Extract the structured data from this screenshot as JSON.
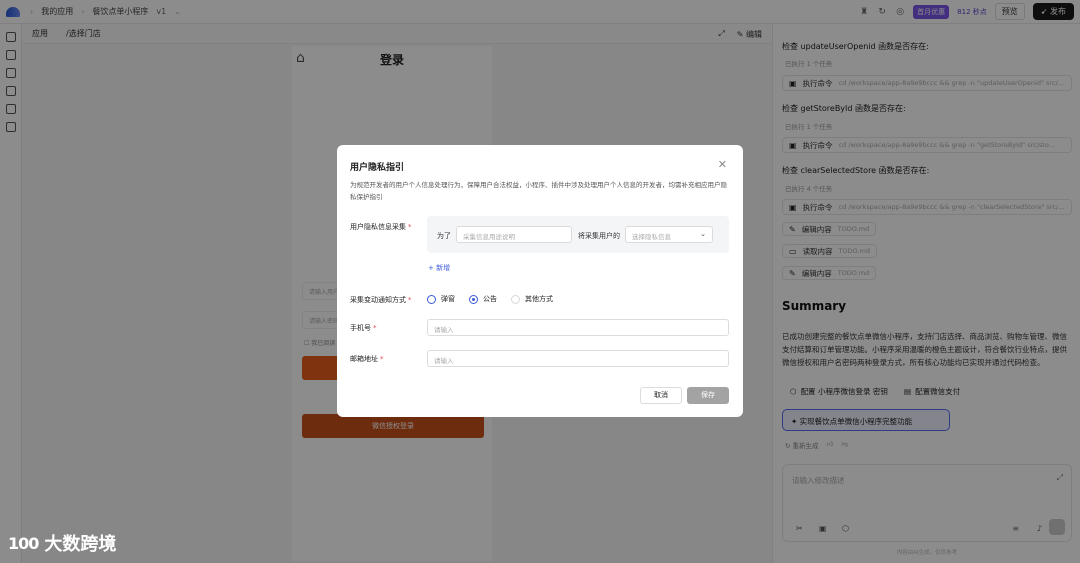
{
  "topbar": {
    "crumb1": "我的应用",
    "crumb2": "餐饮点单小程序",
    "version": "v1",
    "badge": "首月优惠",
    "credits": "812 秒点",
    "preview_btn": "预览",
    "publish_btn": "发布"
  },
  "preview": {
    "tab_app": "应用",
    "tab_path": "/选择门店",
    "edit": "编辑",
    "login_title": "登录",
    "input1": "请输入用户",
    "input2": "请输入密码",
    "check": "我已阅读",
    "wechat_login": "微信授权登录"
  },
  "panel": {
    "check1": "检查 updateUserOpenid 函数是否存在:",
    "sub1": "已执行 1 个任务",
    "cmd_label": "执行命令",
    "cmd1": "cd /workspace/app-8a9e9bccc && grep -n \"updateUserOpenid\" src/...",
    "check2": "检查 getStoreById 函数是否存在:",
    "sub2": "已执行 1 个任务",
    "cmd2": "cd /workspace/app-8a9e9bccc && grep -n \"getStoreById\" src/sto...",
    "check3": "检查 clearSelectedStore 函数是否存在:",
    "sub3": "已执行 4 个任务",
    "cmd3": "cd /workspace/app-8a9e9bccc && grep -n \"clearSelectedStore\" src/...",
    "edit_label": "编辑内容",
    "edit_file": "TODO.md",
    "read_label": "读取内容",
    "read_file": "TODO.md",
    "edit2_label": "编辑内容",
    "edit2_file": "TODO.md",
    "summary_title": "Summary",
    "summary_text": "已成功创建完整的餐饮点单微信小程序，支持门店选择、商品浏览、购物车管理、微信支付结算和订单管理功能。小程序采用温暖的橙色主题设计，符合餐饮行业特点，提供微信授权和用户名密码两种登录方式，所有核心功能均已实现并通过代码检查。",
    "action1": "配置 小程序微信登录 密钥",
    "action2": "配置微信支付",
    "task_tag": "实现餐饮点单微信小程序完整功能",
    "regen": "重新生成",
    "chat_placeholder": "请输入修改描述",
    "footer": "内容由AI生成，仅供参考"
  },
  "dialog": {
    "title": "用户隐私指引",
    "desc": "为规范开发者的用户个人信息处理行为，保障用户合法权益，小程序、插件中涉及处理用户个人信息的开发者，均需补充相应用户隐私保护指引",
    "label_collect": "用户隐私信息采集",
    "for_text": "为了",
    "purpose_placeholder": "采集信息用途说明",
    "will_collect": "将采集用户的",
    "select_placeholder": "选择隐私信息",
    "add_link": "+ 新增",
    "label_notify": "采集变动通知方式",
    "radio1": "弹窗",
    "radio2": "公告",
    "radio3": "其他方式",
    "label_phone": "手机号",
    "phone_placeholder": "请输入",
    "label_email": "邮箱地址",
    "email_placeholder": "请输入",
    "cancel": "取消",
    "save": "保存"
  },
  "watermark": {
    "logo": "100",
    "text": "大数跨境"
  },
  "colors": {
    "accent": "#3b5bdb",
    "brand_orange": "#e85d1a",
    "required": "#e5484d",
    "badge_purple": "#7a55e8"
  }
}
